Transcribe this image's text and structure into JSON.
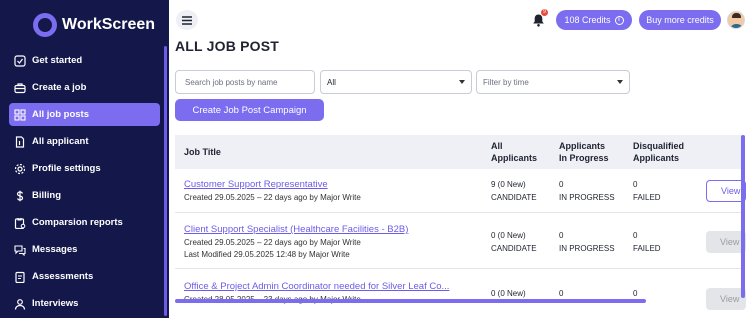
{
  "app": {
    "name": "WorkScreen"
  },
  "sidebar": {
    "items": [
      {
        "label": "Get started",
        "icon": "checkbox-icon"
      },
      {
        "label": "Create a job",
        "icon": "briefcase-icon"
      },
      {
        "label": "All job posts",
        "icon": "grid-icon",
        "active": true
      },
      {
        "label": "All applicant",
        "icon": "document-icon"
      },
      {
        "label": "Profile settings",
        "icon": "gear-icon"
      },
      {
        "label": "Billing",
        "icon": "dollar-icon"
      },
      {
        "label": "Comparsion reports",
        "icon": "report-icon"
      },
      {
        "label": "Messages",
        "icon": "chat-icon"
      },
      {
        "label": "Assessments",
        "icon": "clipboard-icon"
      },
      {
        "label": "Interviews",
        "icon": "user-icon"
      }
    ]
  },
  "topbar": {
    "notification_count": "9",
    "credits_label": "108 Credits",
    "buy_label": "Buy more credits"
  },
  "page": {
    "title": "ALL JOB POST"
  },
  "filters": {
    "search_placeholder": "Search job posts by name",
    "status_value": "All",
    "time_placeholder": "Filter by time",
    "campaign_button": "Create Job Post Campaign"
  },
  "table": {
    "headers": {
      "job_title": "Job Title",
      "all_applicants_1": "All",
      "all_applicants_2": "Applicants",
      "in_progress_1": "Applicants",
      "in_progress_2": "In Progress",
      "disqualified_1": "Disqualified",
      "disqualified_2": "Applicants"
    },
    "rows": [
      {
        "title": "Customer Support Representative",
        "created": "Created 29.05.2025 – 22 days ago by Major Write",
        "modified": "",
        "all_count": "9 (0 New)",
        "all_label": "CANDIDATE",
        "progress_count": "0",
        "progress_label": "IN PROGRESS",
        "failed_count": "0",
        "failed_label": "FAILED",
        "view": "View"
      },
      {
        "title": "Client Support Specialist (Healthcare Facilities - B2B)",
        "created": "Created 29.05.2025 – 22 days ago by Major Write",
        "modified": "Last Modified 29.05.2025 12:48 by Major Write",
        "all_count": "0 (0 New)",
        "all_label": "CANDIDATE",
        "progress_count": "0",
        "progress_label": "IN PROGRESS",
        "failed_count": "0",
        "failed_label": "FAILED",
        "view": "View"
      },
      {
        "title": "Office & Project Admin Coordinator needed for Silver Leaf Co...",
        "created": "Created 28.05.2025 – 23 days ago by Major Write",
        "all_count": "0 (0 New)",
        "progress_count": "0",
        "failed_count": "0",
        "view": "View"
      }
    ]
  },
  "colors": {
    "accent": "#7b6cf0",
    "sidebar": "#14174a"
  }
}
